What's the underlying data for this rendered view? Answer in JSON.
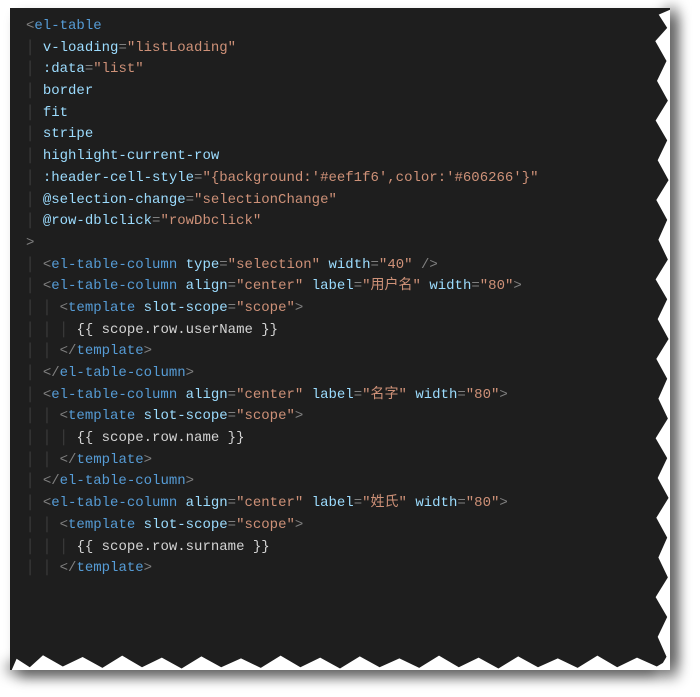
{
  "code": {
    "lines": [
      {
        "indent": 0,
        "segs": [
          {
            "c": "punct",
            "t": "<"
          },
          {
            "c": "tag",
            "t": "el-table"
          }
        ]
      },
      {
        "indent": 1,
        "segs": [
          {
            "c": "attr",
            "t": "v-loading"
          },
          {
            "c": "punct",
            "t": "="
          },
          {
            "c": "str",
            "t": "\"listLoading\""
          }
        ]
      },
      {
        "indent": 1,
        "segs": [
          {
            "c": "attr",
            "t": ":data"
          },
          {
            "c": "punct",
            "t": "="
          },
          {
            "c": "str",
            "t": "\"list\""
          }
        ]
      },
      {
        "indent": 1,
        "segs": [
          {
            "c": "attr",
            "t": "border"
          }
        ]
      },
      {
        "indent": 1,
        "segs": [
          {
            "c": "attr",
            "t": "fit"
          }
        ]
      },
      {
        "indent": 1,
        "segs": [
          {
            "c": "attr",
            "t": "stripe"
          }
        ]
      },
      {
        "indent": 1,
        "segs": [
          {
            "c": "attr",
            "t": "highlight-current-row"
          }
        ]
      },
      {
        "indent": 1,
        "segs": [
          {
            "c": "attr",
            "t": ":header-cell-style"
          },
          {
            "c": "punct",
            "t": "="
          },
          {
            "c": "str",
            "t": "\"{background:'#eef1f6',color:'#606266'}\""
          }
        ]
      },
      {
        "indent": 1,
        "segs": [
          {
            "c": "attr",
            "t": "@selection-change"
          },
          {
            "c": "punct",
            "t": "="
          },
          {
            "c": "str",
            "t": "\"selectionChange\""
          }
        ]
      },
      {
        "indent": 1,
        "segs": [
          {
            "c": "attr",
            "t": "@row-dblclick"
          },
          {
            "c": "punct",
            "t": "="
          },
          {
            "c": "str",
            "t": "\"rowDbclick\""
          }
        ]
      },
      {
        "indent": 0,
        "segs": [
          {
            "c": "punct",
            "t": ">"
          }
        ]
      },
      {
        "indent": 1,
        "segs": [
          {
            "c": "punct",
            "t": "<"
          },
          {
            "c": "tag",
            "t": "el-table-column"
          },
          {
            "c": "txt",
            "t": " "
          },
          {
            "c": "attr",
            "t": "type"
          },
          {
            "c": "punct",
            "t": "="
          },
          {
            "c": "str",
            "t": "\"selection\""
          },
          {
            "c": "txt",
            "t": " "
          },
          {
            "c": "attr",
            "t": "width"
          },
          {
            "c": "punct",
            "t": "="
          },
          {
            "c": "str",
            "t": "\"40\""
          },
          {
            "c": "txt",
            "t": " "
          },
          {
            "c": "punct",
            "t": "/>"
          }
        ]
      },
      {
        "indent": 1,
        "segs": [
          {
            "c": "punct",
            "t": "<"
          },
          {
            "c": "tag",
            "t": "el-table-column"
          },
          {
            "c": "txt",
            "t": " "
          },
          {
            "c": "attr",
            "t": "align"
          },
          {
            "c": "punct",
            "t": "="
          },
          {
            "c": "str",
            "t": "\"center\""
          },
          {
            "c": "txt",
            "t": " "
          },
          {
            "c": "attr",
            "t": "label"
          },
          {
            "c": "punct",
            "t": "="
          },
          {
            "c": "str",
            "t": "\"用户名\""
          },
          {
            "c": "txt",
            "t": " "
          },
          {
            "c": "attr",
            "t": "width"
          },
          {
            "c": "punct",
            "t": "="
          },
          {
            "c": "str",
            "t": "\"80\""
          },
          {
            "c": "punct",
            "t": ">"
          }
        ]
      },
      {
        "indent": 2,
        "segs": [
          {
            "c": "punct",
            "t": "<"
          },
          {
            "c": "tag",
            "t": "template"
          },
          {
            "c": "txt",
            "t": " "
          },
          {
            "c": "attr",
            "t": "slot-scope"
          },
          {
            "c": "punct",
            "t": "="
          },
          {
            "c": "str",
            "t": "\"scope\""
          },
          {
            "c": "punct",
            "t": ">"
          }
        ]
      },
      {
        "indent": 3,
        "segs": [
          {
            "c": "txt",
            "t": "{{ scope.row.userName }}"
          }
        ]
      },
      {
        "indent": 2,
        "segs": [
          {
            "c": "punct",
            "t": "</"
          },
          {
            "c": "tag",
            "t": "template"
          },
          {
            "c": "punct",
            "t": ">"
          }
        ]
      },
      {
        "indent": 1,
        "segs": [
          {
            "c": "punct",
            "t": "</"
          },
          {
            "c": "tag",
            "t": "el-table-column"
          },
          {
            "c": "punct",
            "t": ">"
          }
        ]
      },
      {
        "indent": 1,
        "segs": [
          {
            "c": "punct",
            "t": "<"
          },
          {
            "c": "tag",
            "t": "el-table-column"
          },
          {
            "c": "txt",
            "t": " "
          },
          {
            "c": "attr",
            "t": "align"
          },
          {
            "c": "punct",
            "t": "="
          },
          {
            "c": "str",
            "t": "\"center\""
          },
          {
            "c": "txt",
            "t": " "
          },
          {
            "c": "attr",
            "t": "label"
          },
          {
            "c": "punct",
            "t": "="
          },
          {
            "c": "str",
            "t": "\"名字\""
          },
          {
            "c": "txt",
            "t": " "
          },
          {
            "c": "attr",
            "t": "width"
          },
          {
            "c": "punct",
            "t": "="
          },
          {
            "c": "str",
            "t": "\"80\""
          },
          {
            "c": "punct",
            "t": ">"
          }
        ]
      },
      {
        "indent": 2,
        "segs": [
          {
            "c": "punct",
            "t": "<"
          },
          {
            "c": "tag",
            "t": "template"
          },
          {
            "c": "txt",
            "t": " "
          },
          {
            "c": "attr",
            "t": "slot-scope"
          },
          {
            "c": "punct",
            "t": "="
          },
          {
            "c": "str",
            "t": "\"scope\""
          },
          {
            "c": "punct",
            "t": ">"
          }
        ]
      },
      {
        "indent": 3,
        "segs": [
          {
            "c": "txt",
            "t": "{{ scope.row.name }}"
          }
        ]
      },
      {
        "indent": 2,
        "segs": [
          {
            "c": "punct",
            "t": "</"
          },
          {
            "c": "tag",
            "t": "template"
          },
          {
            "c": "punct",
            "t": ">"
          }
        ]
      },
      {
        "indent": 1,
        "segs": [
          {
            "c": "punct",
            "t": "</"
          },
          {
            "c": "tag",
            "t": "el-table-column"
          },
          {
            "c": "punct",
            "t": ">"
          }
        ]
      },
      {
        "indent": 1,
        "segs": [
          {
            "c": "punct",
            "t": "<"
          },
          {
            "c": "tag",
            "t": "el-table-column"
          },
          {
            "c": "txt",
            "t": " "
          },
          {
            "c": "attr",
            "t": "align"
          },
          {
            "c": "punct",
            "t": "="
          },
          {
            "c": "str",
            "t": "\"center\""
          },
          {
            "c": "txt",
            "t": " "
          },
          {
            "c": "attr",
            "t": "label"
          },
          {
            "c": "punct",
            "t": "="
          },
          {
            "c": "str",
            "t": "\"姓氏\""
          },
          {
            "c": "txt",
            "t": " "
          },
          {
            "c": "attr",
            "t": "width"
          },
          {
            "c": "punct",
            "t": "="
          },
          {
            "c": "str",
            "t": "\"80\""
          },
          {
            "c": "punct",
            "t": ">"
          }
        ]
      },
      {
        "indent": 2,
        "segs": [
          {
            "c": "punct",
            "t": "<"
          },
          {
            "c": "tag",
            "t": "template"
          },
          {
            "c": "txt",
            "t": " "
          },
          {
            "c": "attr",
            "t": "slot-scope"
          },
          {
            "c": "punct",
            "t": "="
          },
          {
            "c": "str",
            "t": "\"scope\""
          },
          {
            "c": "punct",
            "t": ">"
          }
        ]
      },
      {
        "indent": 3,
        "segs": [
          {
            "c": "txt",
            "t": "{{ scope.row.surname }}"
          }
        ]
      },
      {
        "indent": 2,
        "segs": [
          {
            "c": "punct",
            "t": "</"
          },
          {
            "c": "tag",
            "t": "template"
          },
          {
            "c": "punct",
            "t": ">"
          }
        ]
      }
    ]
  }
}
